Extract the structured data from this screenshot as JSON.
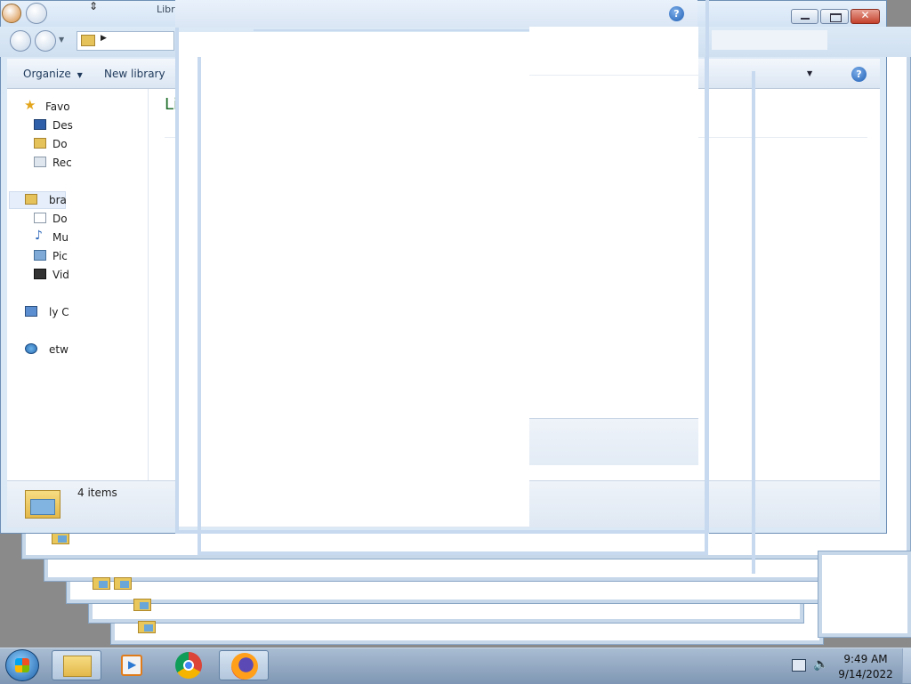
{
  "explorer": {
    "title_fragment": "Libr",
    "toolbar": {
      "organize_label": "Organize",
      "new_library_label": "New library"
    },
    "nav": {
      "favorites_label": "Favo",
      "favorites_items": [
        "Des",
        "Do",
        "Rec"
      ],
      "libraries_label": "bra",
      "library_items": [
        "Do",
        "Mu",
        "Pic",
        "Vid"
      ],
      "computer_label": "ly C",
      "network_label": "etw"
    },
    "content": {
      "heading": "Libraries"
    },
    "status": {
      "items_text": "4 items"
    }
  },
  "help_glyph": "?",
  "taskbar": {
    "clock_time": "9:49 AM",
    "clock_date": "9/14/2022"
  }
}
